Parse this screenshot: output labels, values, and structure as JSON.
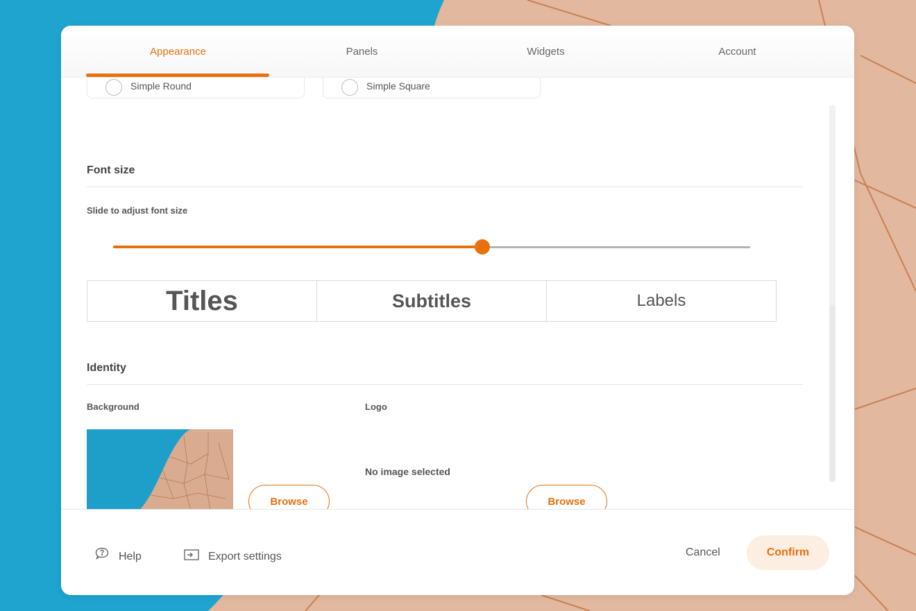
{
  "tabs": [
    {
      "label": "Appearance",
      "active": true
    },
    {
      "label": "Panels",
      "active": false
    },
    {
      "label": "Widgets",
      "active": false
    },
    {
      "label": "Account",
      "active": false
    }
  ],
  "shapes": [
    {
      "label": "Simple Round"
    },
    {
      "label": "Simple Square"
    }
  ],
  "font_size": {
    "title": "Font size",
    "slider_label": "Slide to adjust font size",
    "slider_value": 0.58,
    "preview": {
      "titles": "Titles",
      "subtitles": "Subtitles",
      "labels": "Labels"
    }
  },
  "identity": {
    "title": "Identity",
    "background_label": "Background",
    "logo_label": "Logo",
    "no_image_text": "No image selected",
    "browse_label": "Browse"
  },
  "footer": {
    "help_label": "Help",
    "export_label": "Export settings",
    "cancel_label": "Cancel",
    "confirm_label": "Confirm"
  },
  "colors": {
    "accent": "#e8700f",
    "accent_light": "#fdeee2",
    "pool_blue": "#1fa3cf",
    "tile": "#e3b9a0"
  },
  "icons": {
    "help": "help-bubble-icon",
    "export": "export-icon"
  }
}
